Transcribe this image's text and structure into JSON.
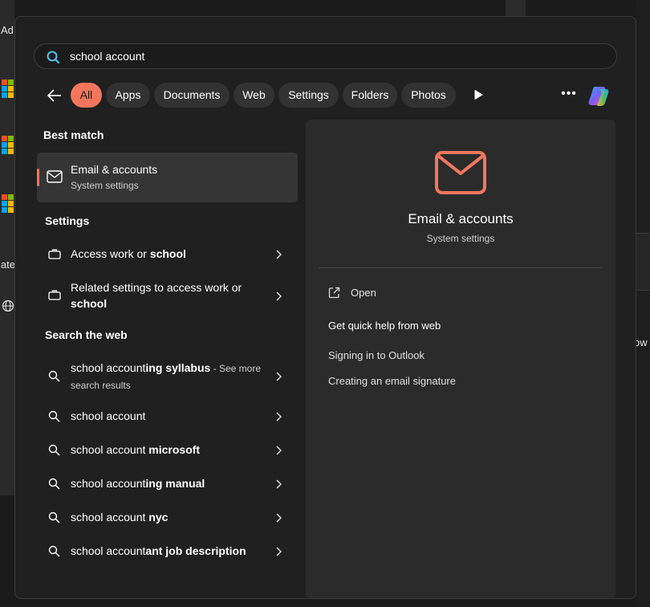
{
  "background": {
    "frag_top": "Ad",
    "frag_mid": "late",
    "frag_right": "ow"
  },
  "search": {
    "value": "school account"
  },
  "filters": [
    "All",
    "Apps",
    "Documents",
    "Web",
    "Settings",
    "Folders",
    "Photos"
  ],
  "best_match": {
    "heading": "Best match",
    "title": "Email & accounts",
    "subtitle": "System settings"
  },
  "settings": {
    "heading": "Settings",
    "items": [
      {
        "pre": "Access work or ",
        "bold": "school"
      },
      {
        "pre": "Related settings to access work or ",
        "bold": "school"
      }
    ]
  },
  "web": {
    "heading": "Search the web",
    "items": [
      {
        "pre": "school account",
        "bold": "ing syllabus",
        "extra": " - See more search results"
      },
      {
        "pre": "school account",
        "bold": "",
        "extra": ""
      },
      {
        "pre": "school account",
        "bold": " microsoft",
        "extra": ""
      },
      {
        "pre": "school account",
        "bold": "ing manual",
        "extra": ""
      },
      {
        "pre": "school account",
        "bold": " nyc",
        "extra": ""
      },
      {
        "pre": "school account",
        "bold": "ant job description",
        "extra": ""
      }
    ]
  },
  "preview": {
    "title": "Email & accounts",
    "subtitle": "System settings",
    "open": "Open",
    "help_heading": "Get quick help from web",
    "links": [
      "Signing in to Outlook",
      "Creating an email signature"
    ]
  },
  "colors": {
    "accent": "#f2765d",
    "window": "#202020",
    "pane": "#2b2b2b"
  }
}
